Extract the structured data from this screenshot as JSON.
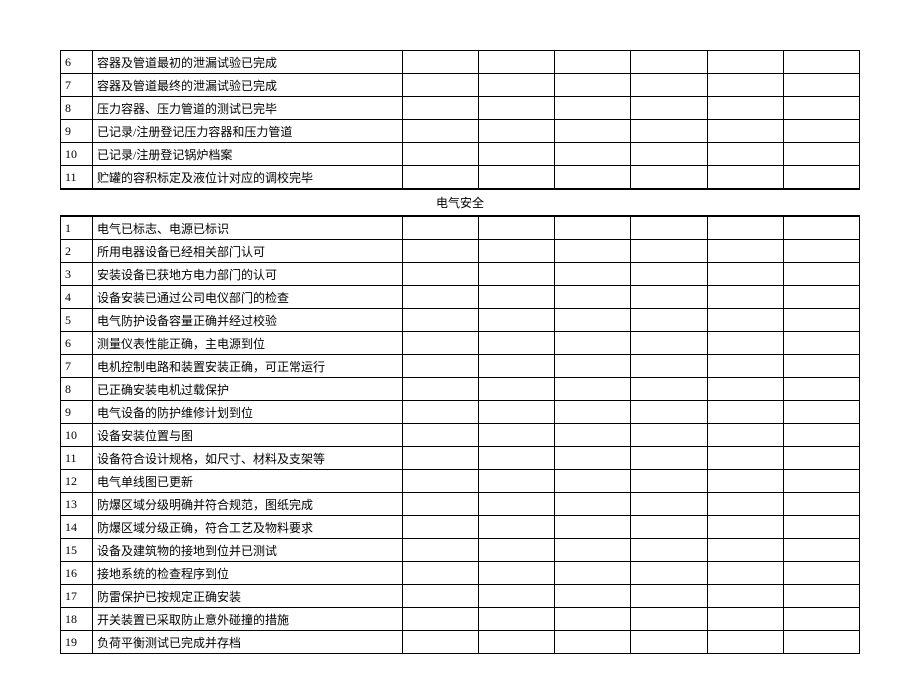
{
  "section1": {
    "rows": [
      {
        "num": "6",
        "desc": "容器及管道最初的泄漏试验已完成"
      },
      {
        "num": "7",
        "desc": "容器及管道最终的泄漏试验已完成"
      },
      {
        "num": "8",
        "desc": "压力容器、压力管道的测试已完毕"
      },
      {
        "num": "9",
        "desc": "已记录/注册登记压力容器和压力管道"
      },
      {
        "num": "10",
        "desc": "已记录/注册登记锅炉档案"
      },
      {
        "num": "11",
        "desc": "贮罐的容积标定及液位计对应的调校完毕"
      }
    ]
  },
  "section2": {
    "header": "电气安全",
    "rows": [
      {
        "num": "1",
        "desc": "电气已标志、电源已标识"
      },
      {
        "num": "2",
        "desc": "所用电器设备已经相关部门认可"
      },
      {
        "num": "3",
        "desc": "安装设备已获地方电力部门的认可"
      },
      {
        "num": "4",
        "desc": "设备安装已通过公司电仪部门的检查"
      },
      {
        "num": "5",
        "desc": "电气防护设备容量正确并经过校验"
      },
      {
        "num": "6",
        "desc": "测量仪表性能正确，主电源到位"
      },
      {
        "num": "7",
        "desc": "电机控制电路和装置安装正确，可正常运行"
      },
      {
        "num": "8",
        "desc": "已正确安装电机过载保护"
      },
      {
        "num": "9",
        "desc": "电气设备的防护维修计划到位"
      },
      {
        "num": "10",
        "desc": "设备安装位置与图"
      },
      {
        "num": "11",
        "desc": "设备符合设计规格，如尺寸、材料及支架等"
      },
      {
        "num": "12",
        "desc": "电气单线图已更新"
      },
      {
        "num": "13",
        "desc": "防爆区域分级明确并符合规范，图纸完成"
      },
      {
        "num": "14",
        "desc": "防爆区域分级正确，符合工艺及物料要求"
      },
      {
        "num": "15",
        "desc": "设备及建筑物的接地到位并已测试"
      },
      {
        "num": "16",
        "desc": "接地系统的检查程序到位"
      },
      {
        "num": "17",
        "desc": "防雷保护已按规定正确安装"
      },
      {
        "num": "18",
        "desc": "开关装置已采取防止意外碰撞的措施"
      },
      {
        "num": "19",
        "desc": "负荷平衡测试已完成并存档"
      }
    ]
  }
}
